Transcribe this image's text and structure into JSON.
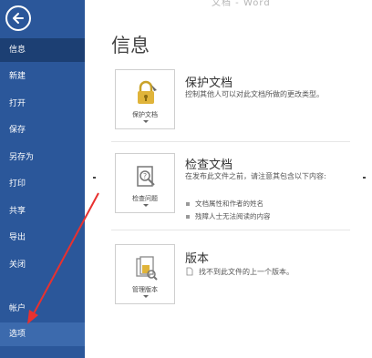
{
  "window": {
    "title_fragment": "文档 - Word"
  },
  "sidebar": {
    "items": [
      {
        "label": "信息"
      },
      {
        "label": "新建"
      },
      {
        "label": "打开"
      },
      {
        "label": "保存"
      },
      {
        "label": "另存为"
      },
      {
        "label": "打印"
      },
      {
        "label": "共享"
      },
      {
        "label": "导出"
      },
      {
        "label": "关闭"
      },
      {
        "label": "帐户"
      },
      {
        "label": "选项"
      }
    ]
  },
  "main": {
    "title": "信息",
    "sections": [
      {
        "tile_label": "保护文档",
        "title": "保护文档",
        "description": "控制其他人可以对此文档所做的更改类型。",
        "icon": "lock-icon"
      },
      {
        "tile_label": "检查问题",
        "title": "检查文档",
        "description": "在发布此文件之前，请注意其包含以下内容:",
        "bullets": [
          "文档属性和作者的姓名",
          "残障人士无法阅读的内容"
        ],
        "icon": "inspect-icon"
      },
      {
        "tile_label": "管理版本",
        "title": "版本",
        "description": "找不到此文件的上一个版本。",
        "icon": "manage-versions-icon"
      }
    ]
  },
  "colors": {
    "sidebar": "#2b579a",
    "sidebar_active": "#1c3f73",
    "annotation_arrow": "#e8312f"
  }
}
